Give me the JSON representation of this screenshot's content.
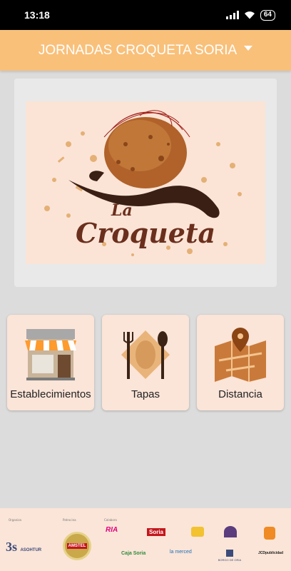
{
  "status_bar": {
    "time": "13:18",
    "battery": "64",
    "icons": [
      "signal-icon",
      "wifi-icon",
      "battery-icon"
    ]
  },
  "app_bar": {
    "title": "JORNADAS CROQUETA SORIA",
    "dropdown_icon": "dropdown-arrow-icon"
  },
  "banner": {
    "script_title_line1": "La",
    "script_title_line2": "Croqueta"
  },
  "tiles": [
    {
      "label": "Establecimientos",
      "icon": "storefront-icon"
    },
    {
      "label": "Tapas",
      "icon": "cutlery-plate-icon"
    },
    {
      "label": "Distancia",
      "icon": "map-pin-icon"
    }
  ],
  "sponsors": {
    "captions": [
      "Organiza",
      "Patrocina",
      "Colabora"
    ],
    "logos": {
      "asohtur": "ASOHTUR",
      "amstel": "AMSTEL",
      "ria": "RIA",
      "soria": "Soria",
      "caja_rural": "Caja",
      "caja_rural_suffix": "Soria",
      "la_merced": "la merced",
      "borgo": "BORGO DE ORIA",
      "jcd": "JCDpublicidad"
    }
  },
  "colors": {
    "app_bar": "#f9c07a",
    "tile_bg": "#fbe4d8",
    "background": "#dcdcdc",
    "brand_brown": "#6b2f1d"
  }
}
